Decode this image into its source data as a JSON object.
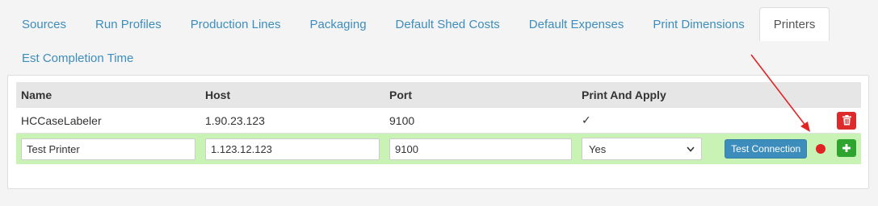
{
  "tabs": [
    {
      "label": "Sources"
    },
    {
      "label": "Run Profiles"
    },
    {
      "label": "Production Lines"
    },
    {
      "label": "Packaging"
    },
    {
      "label": "Default Shed Costs"
    },
    {
      "label": "Default Expenses"
    },
    {
      "label": "Print Dimensions"
    },
    {
      "label": "Printers",
      "active": true
    },
    {
      "label": "Est Completion Time"
    }
  ],
  "table": {
    "headers": {
      "name": "Name",
      "host": "Host",
      "port": "Port",
      "print_apply": "Print And Apply"
    },
    "rows": [
      {
        "name": "HCCaseLabeler",
        "host": "1.90.23.123",
        "port": "9100",
        "print_apply": "✓"
      }
    ],
    "new_row": {
      "name": "Test Printer",
      "host": "1.123.12.123",
      "port": "9100",
      "print_apply": "Yes",
      "test_button": "Test Connection"
    }
  },
  "colors": {
    "accent": "#3c8dbc",
    "delete": "#dd2a2a",
    "add": "#2ea52e",
    "new_row_bg": "#c8f3b4",
    "status": "#e02424",
    "annotation": "#e02424"
  },
  "icons": {
    "delete": "trash-icon",
    "add": "plus-icon",
    "status": "status-dot-icon",
    "select": "chevron-down-icon"
  }
}
